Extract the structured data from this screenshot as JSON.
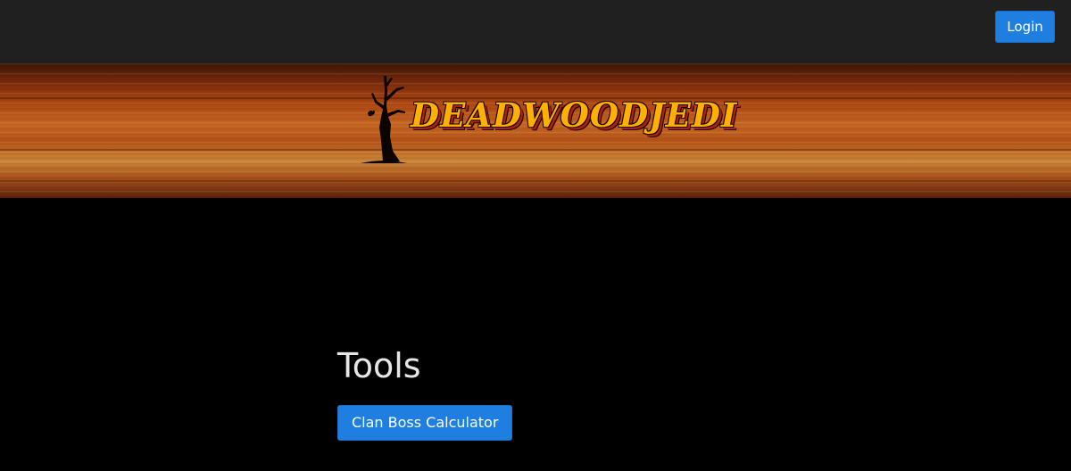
{
  "navbar": {
    "login_label": "Login"
  },
  "banner": {
    "logo_text": "DEADWOODJEDI",
    "logo_icon": "dead-tree-icon"
  },
  "main": {
    "title": "Tools",
    "tools": [
      {
        "label": "Clan Boss Calculator"
      }
    ]
  },
  "colors": {
    "navbar_bg": "#202020",
    "page_bg": "#000000",
    "button_bg": "#1e7fe0",
    "logo_text": "#ffb000",
    "logo_shadow": "#b02010"
  }
}
